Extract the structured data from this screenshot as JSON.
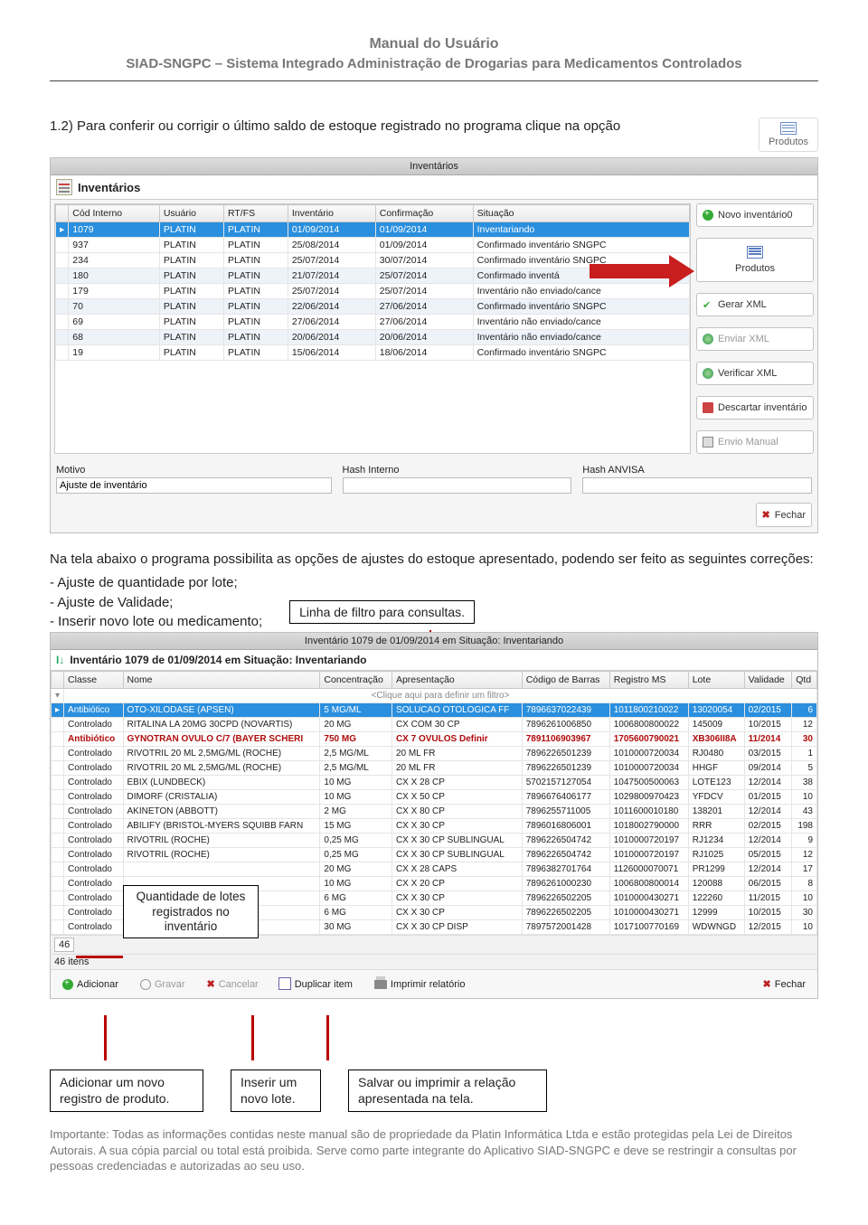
{
  "doc": {
    "title": "Manual do Usuário",
    "subtitle": "SIAD-SNGPC – Sistema Integrado Administração de Drogarias para Medicamentos Controlados"
  },
  "intro": "1.2) Para conferir ou corrigir o último saldo de estoque registrado no programa clique na opção",
  "produtos_label": "Produtos",
  "win1": {
    "title": "Inventários",
    "panel": "Inventários",
    "headers": [
      "Cód Interno",
      "Usuário",
      "RT/FS",
      "Inventário",
      "Confirmação",
      "Situação"
    ],
    "rows": [
      {
        "cod": "1079",
        "usuario": "PLATIN",
        "rt": "PLATIN",
        "inv": "01/09/2014",
        "conf": "01/09/2014",
        "sit": "Inventariando",
        "sel": true
      },
      {
        "cod": "937",
        "usuario": "PLATIN",
        "rt": "PLATIN",
        "inv": "25/08/2014",
        "conf": "01/09/2014",
        "sit": "Confirmado inventário SNGPC"
      },
      {
        "cod": "234",
        "usuario": "PLATIN",
        "rt": "PLATIN",
        "inv": "25/07/2014",
        "conf": "30/07/2014",
        "sit": "Confirmado inventário SNGPC"
      },
      {
        "cod": "180",
        "usuario": "PLATIN",
        "rt": "PLATIN",
        "inv": "21/07/2014",
        "conf": "25/07/2014",
        "sit": "Confirmado inventá",
        "alt": true
      },
      {
        "cod": "179",
        "usuario": "PLATIN",
        "rt": "PLATIN",
        "inv": "25/07/2014",
        "conf": "25/07/2014",
        "sit": "Inventário não enviado/cance"
      },
      {
        "cod": "70",
        "usuario": "PLATIN",
        "rt": "PLATIN",
        "inv": "22/06/2014",
        "conf": "27/06/2014",
        "sit": "Confirmado inventário SNGPC",
        "alt": true
      },
      {
        "cod": "69",
        "usuario": "PLATIN",
        "rt": "PLATIN",
        "inv": "27/06/2014",
        "conf": "27/06/2014",
        "sit": "Inventário não enviado/cance"
      },
      {
        "cod": "68",
        "usuario": "PLATIN",
        "rt": "PLATIN",
        "inv": "20/06/2014",
        "conf": "20/06/2014",
        "sit": "Inventário não enviado/cance",
        "alt": true
      },
      {
        "cod": "19",
        "usuario": "PLATIN",
        "rt": "PLATIN",
        "inv": "15/06/2014",
        "conf": "18/06/2014",
        "sit": "Confirmado inventário SNGPC"
      }
    ],
    "actions": {
      "novo": "Novo inventário0",
      "produtos": "Produtos",
      "gerar": "Gerar XML",
      "enviar": "Enviar XML",
      "verificar": "Verificar XML",
      "descartar": "Descartar inventário",
      "envio": "Envio Manual",
      "fechar": "Fechar"
    },
    "motivo_label": "Motivo",
    "motivo_value": "Ajuste de inventário",
    "hash_interno_label": "Hash Interno",
    "hash_anvisa_label": "Hash ANVISA"
  },
  "para2": "Na tela abaixo o programa possibilita as opções de ajustes do estoque apresentado, podendo ser feito as seguintes correções:",
  "bul1": "- Ajuste de quantidade por lote;",
  "bul2": "- Ajuste de Validade;",
  "bul3": "- Inserir  novo lote ou medicamento;",
  "filter_callout": "Linha de filtro para consultas.",
  "win2": {
    "title": "Inventário 1079 de 01/09/2014 em Situação: Inventariando",
    "panel": "Inventário 1079 de 01/09/2014 em Situação: Inventariando",
    "headers": [
      "Classe",
      "Nome",
      "Concentração",
      "Apresentação",
      "Código de Barras",
      "Registro MS",
      "Lote",
      "Validade",
      "Qtd"
    ],
    "filter_hint": "<Clique aqui para definir um filtro>",
    "rows": [
      {
        "classe": "Antibiótico",
        "nome": "OTO-XILODASE (APSEN)",
        "conc": "5 MG/ML",
        "apres": "SOLUCAO OTOLOGICA FF",
        "cod": "7896637022439",
        "reg": "1011800210022",
        "lote": "13020054",
        "val": "02/2015",
        "qtd": "6",
        "sel": true
      },
      {
        "classe": "Controlado",
        "nome": "RITALINA LA 20MG 30CPD (NOVARTIS)",
        "conc": "20 MG",
        "apres": "CX COM 30 CP",
        "cod": "7896261006850",
        "reg": "1006800800022",
        "lote": "145009",
        "val": "10/2015",
        "qtd": "12"
      },
      {
        "classe": "Antibiótico",
        "nome": "GYNOTRAN OVULO C/7 (BAYER SCHERI",
        "conc": "750 MG",
        "apres": "CX 7 OVULOS Definir",
        "cod": "7891106903967",
        "reg": "1705600790021",
        "lote": "XB306II8A",
        "val": "11/2014",
        "qtd": "30",
        "red": true
      },
      {
        "classe": "Controlado",
        "nome": "RIVOTRIL 20 ML 2,5MG/ML (ROCHE)",
        "conc": "2,5 MG/ML",
        "apres": "20 ML FR",
        "cod": "7896226501239",
        "reg": "1010000720034",
        "lote": "RJ0480",
        "val": "03/2015",
        "qtd": "1"
      },
      {
        "classe": "Controlado",
        "nome": "RIVOTRIL 20 ML 2,5MG/ML (ROCHE)",
        "conc": "2,5 MG/ML",
        "apres": "20 ML FR",
        "cod": "7896226501239",
        "reg": "1010000720034",
        "lote": "HHGF",
        "val": "09/2014",
        "qtd": "5"
      },
      {
        "classe": "Controlado",
        "nome": "EBIX (LUNDBECK)",
        "conc": "10 MG",
        "apres": "CX X 28 CP",
        "cod": "5702157127054",
        "reg": "1047500500063",
        "lote": "LOTE123",
        "val": "12/2014",
        "qtd": "38"
      },
      {
        "classe": "Controlado",
        "nome": "DIMORF (CRISTALIA)",
        "conc": "10 MG",
        "apres": "CX X 50 CP",
        "cod": "7896676406177",
        "reg": "1029800970423",
        "lote": "YFDCV",
        "val": "01/2015",
        "qtd": "10"
      },
      {
        "classe": "Controlado",
        "nome": "AKINETON (ABBOTT)",
        "conc": "2 MG",
        "apres": "CX X 80 CP",
        "cod": "7896255711005",
        "reg": "1011600010180",
        "lote": "138201",
        "val": "12/2014",
        "qtd": "43"
      },
      {
        "classe": "Controlado",
        "nome": "ABILIFY (BRISTOL-MYERS SQUIBB FARN",
        "conc": "15 MG",
        "apres": "CX X 30 CP",
        "cod": "7896016806001",
        "reg": "1018002790000",
        "lote": "RRR",
        "val": "02/2015",
        "qtd": "198"
      },
      {
        "classe": "Controlado",
        "nome": "RIVOTRIL (ROCHE)",
        "conc": "0,25 MG",
        "apres": "CX X 30 CP SUBLINGUAL",
        "cod": "7896226504742",
        "reg": "1010000720197",
        "lote": "RJ1234",
        "val": "12/2014",
        "qtd": "9"
      },
      {
        "classe": "Controlado",
        "nome": "RIVOTRIL (ROCHE)",
        "conc": "0,25 MG",
        "apres": "CX X 30 CP SUBLINGUAL",
        "cod": "7896226504742",
        "reg": "1010000720197",
        "lote": "RJ1025",
        "val": "05/2015",
        "qtd": "12"
      },
      {
        "classe": "Controlado",
        "nome": "",
        "conc": "20 MG",
        "apres": "CX X 28 CAPS",
        "cod": "7896382701764",
        "reg": "1126000070071",
        "lote": "PR1299",
        "val": "12/2014",
        "qtd": "17"
      },
      {
        "classe": "Controlado",
        "nome": "",
        "conc": "10 MG",
        "apres": "CX X 20 CP",
        "cod": "7896261000230",
        "reg": "1006800800014",
        "lote": "120088",
        "val": "06/2015",
        "qtd": "8"
      },
      {
        "classe": "Controlado",
        "nome": "",
        "conc": "6 MG",
        "apres": "CX X 30 CP",
        "cod": "7896226502205",
        "reg": "1010000430271",
        "lote": "122260",
        "val": "11/2015",
        "qtd": "10"
      },
      {
        "classe": "Controlado",
        "nome": "",
        "conc": "6 MG",
        "apres": "CX X 30 CP",
        "cod": "7896226502205",
        "reg": "1010000430271",
        "lote": "12999",
        "val": "10/2015",
        "qtd": "30"
      },
      {
        "classe": "Controlado",
        "nome": "",
        "conc": "30 MG",
        "apres": "CX X 30 CP DISP",
        "cod": "7897572001428",
        "reg": "1017100770169",
        "lote": "WDWNGD",
        "val": "12/2015",
        "qtd": "10"
      }
    ],
    "count_value": "46",
    "items_label": "46 itens",
    "toolbar": {
      "adicionar": "Adicionar",
      "gravar": "Gravar",
      "cancelar": "Cancelar",
      "duplicar": "Duplicar item",
      "imprimir": "Imprimir relatório",
      "fechar": "Fechar"
    }
  },
  "qty_callout": "Quantidade de lotes registrados no inventário",
  "callouts": {
    "adicionar": "Adicionar um novo registro de produto.",
    "inserir": "Inserir um novo lote.",
    "salvar": "Salvar ou imprimir a relação apresentada na tela."
  },
  "footnote": "Importante: Todas as informações contidas neste manual são de propriedade da Platin Informática Ltda e estão protegidas pela Lei de Direitos Autorais. A sua cópia parcial ou total está proibida. Serve como parte integrante do Aplicativo SIAD-SNGPC e deve se restringir a consultas por pessoas credenciadas e autorizadas ao seu uso."
}
